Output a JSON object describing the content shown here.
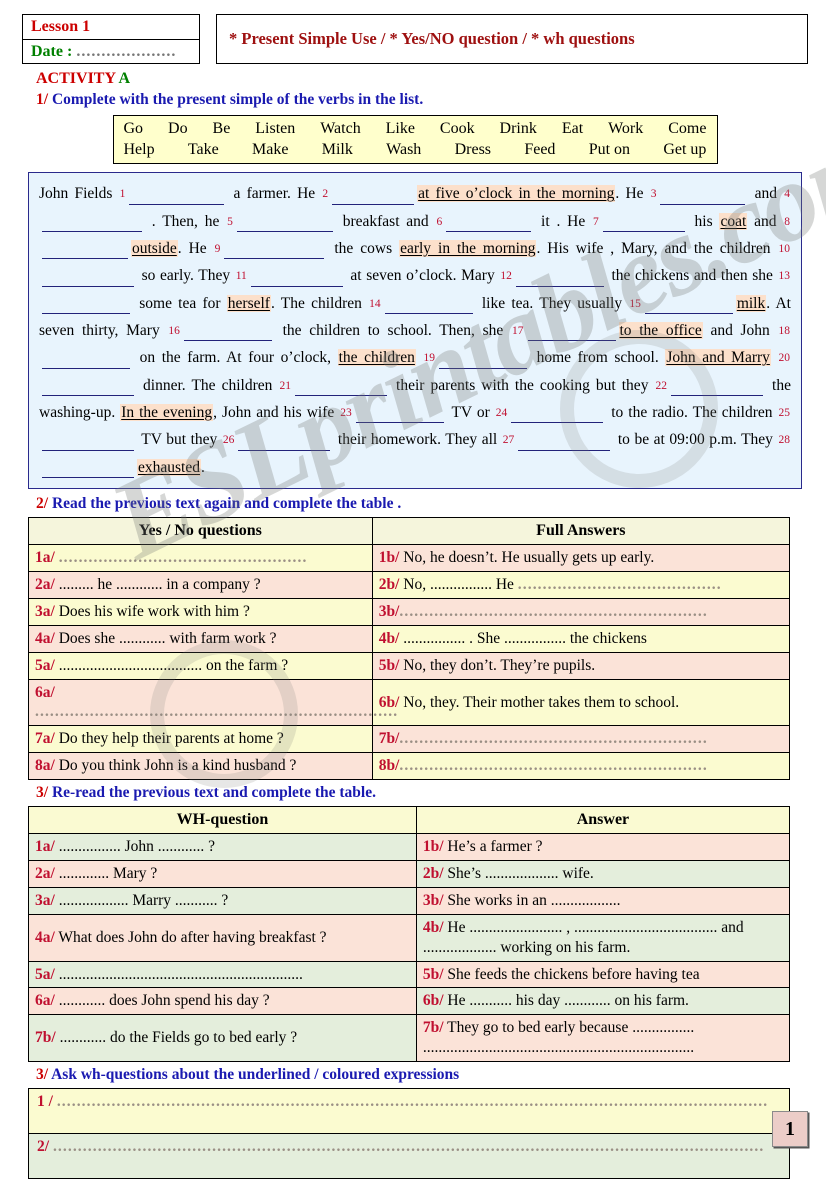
{
  "header": {
    "lesson": "Lesson 1",
    "date_label": "Date :",
    "date_dots": "....................",
    "topics": "* Present Simple Use   /  * Yes/NO question  /  * wh questions"
  },
  "activity": {
    "word": "ACTIVITY",
    "letter": "A"
  },
  "instructions": {
    "one_num": "1/",
    "one_text": "Complete with the present simple of the verbs in the list.",
    "two_num": "2/",
    "two_text": "Read the previous text again and complete the table .",
    "three_num": "3/",
    "three_text": "Re-read the previous text and complete the table.",
    "four_num": "3/",
    "four_text": "Ask wh-questions about the underlined / coloured expressions"
  },
  "verb_list": {
    "row1": [
      "Go",
      "Do",
      "Be",
      "Listen",
      "Watch",
      "Like",
      "Cook",
      "Drink",
      "Eat",
      "Work",
      "Come"
    ],
    "row2": [
      "Help",
      "Take",
      "Make",
      "Milk",
      "Wash",
      "Dress",
      "Feed",
      "Put on",
      "Get up"
    ]
  },
  "passage": {
    "segments": [
      {
        "t": "text",
        "v": "John Fields "
      },
      {
        "t": "num",
        "v": "1"
      },
      {
        "t": "gap",
        "w": 95
      },
      {
        "t": "text",
        "v": " a farmer. He "
      },
      {
        "t": "num",
        "v": "2"
      },
      {
        "t": "gap",
        "w": 82
      },
      {
        "t": "hl",
        "v": "at five o’clock in the morning"
      },
      {
        "t": "text",
        "v": ". He "
      },
      {
        "t": "num",
        "v": "3"
      },
      {
        "t": "gap",
        "w": 85
      },
      {
        "t": "text",
        "v": " and "
      },
      {
        "t": "num",
        "v": "4"
      },
      {
        "t": "gap",
        "w": 100
      },
      {
        "t": "text",
        "v": " . Then, he "
      },
      {
        "t": "num",
        "v": "5"
      },
      {
        "t": "gap",
        "w": 96
      },
      {
        "t": "text",
        "v": " breakfast and "
      },
      {
        "t": "num",
        "v": "6"
      },
      {
        "t": "gap",
        "w": 85
      },
      {
        "t": "text",
        "v": " it . He "
      },
      {
        "t": "num",
        "v": "7"
      },
      {
        "t": "gap",
        "w": 82
      },
      {
        "t": "text",
        "v": " his "
      },
      {
        "t": "hl",
        "v": "coat"
      },
      {
        "t": "text",
        "v": " and "
      },
      {
        "t": "num",
        "v": "8"
      },
      {
        "t": "gap",
        "w": 86
      },
      {
        "t": "hl",
        "v": "outside"
      },
      {
        "t": "text",
        "v": ". He "
      },
      {
        "t": "num",
        "v": "9"
      },
      {
        "t": "gap",
        "w": 100
      },
      {
        "t": "text",
        "v": " the cows "
      },
      {
        "t": "hl",
        "v": "early in the morning"
      },
      {
        "t": "text",
        "v": ". His wife , Mary, and the children "
      },
      {
        "t": "num",
        "v": "10"
      },
      {
        "t": "gap",
        "w": 92
      },
      {
        "t": "text",
        "v": " so early. They "
      },
      {
        "t": "num",
        "v": "11"
      },
      {
        "t": "gap",
        "w": 92
      },
      {
        "t": "text",
        "v": " at seven o’clock. Mary "
      },
      {
        "t": "num",
        "v": "12"
      },
      {
        "t": "gap",
        "w": 88
      },
      {
        "t": "text",
        "v": " the chickens and then she "
      },
      {
        "t": "num",
        "v": "13"
      },
      {
        "t": "gap",
        "w": 88
      },
      {
        "t": "text",
        "v": " some tea for "
      },
      {
        "t": "hl",
        "v": "herself"
      },
      {
        "t": "text",
        "v": ". The children "
      },
      {
        "t": "num",
        "v": "14"
      },
      {
        "t": "gap",
        "w": 88
      },
      {
        "t": "text",
        "v": " like tea. They usually "
      },
      {
        "t": "num",
        "v": "15"
      },
      {
        "t": "gap",
        "w": 88
      },
      {
        "t": "hl",
        "v": "milk"
      },
      {
        "t": "text",
        "v": ". At seven thirty, Mary "
      },
      {
        "t": "num",
        "v": "16"
      },
      {
        "t": "gap",
        "w": 88
      },
      {
        "t": "text",
        "v": " the children to school. Then, she "
      },
      {
        "t": "num",
        "v": "17"
      },
      {
        "t": "gap",
        "w": 88
      },
      {
        "t": "hl",
        "v": "to the office"
      },
      {
        "t": "text",
        "v": " and John "
      },
      {
        "t": "num",
        "v": "18"
      },
      {
        "t": "gap",
        "w": 88
      },
      {
        "t": "text",
        "v": " on the farm. At four o’clock, "
      },
      {
        "t": "hl",
        "v": "the children"
      },
      {
        "t": "text",
        "v": " "
      },
      {
        "t": "num",
        "v": "19"
      },
      {
        "t": "gap",
        "w": 88
      },
      {
        "t": "text",
        "v": " home from school. "
      },
      {
        "t": "hl",
        "v": "John and Marry"
      },
      {
        "t": "text",
        "v": " "
      },
      {
        "t": "num",
        "v": "20"
      },
      {
        "t": "gap",
        "w": 92
      },
      {
        "t": "text",
        "v": " dinner. The children "
      },
      {
        "t": "num",
        "v": "21"
      },
      {
        "t": "gap",
        "w": 92
      },
      {
        "t": "text",
        "v": " their parents with the cooking but they "
      },
      {
        "t": "num",
        "v": "22"
      },
      {
        "t": "gap",
        "w": 92
      },
      {
        "t": "text",
        "v": " the washing-up. "
      },
      {
        "t": "hl",
        "v": "In the evening"
      },
      {
        "t": "text",
        "v": ", John and his wife "
      },
      {
        "t": "num",
        "v": "23"
      },
      {
        "t": "gap",
        "w": 88
      },
      {
        "t": "text",
        "v": " TV or "
      },
      {
        "t": "num",
        "v": "24"
      },
      {
        "t": "gap",
        "w": 92
      },
      {
        "t": "text",
        "v": " to the radio. The children "
      },
      {
        "t": "num",
        "v": "25"
      },
      {
        "t": "gap",
        "w": 92
      },
      {
        "t": "text",
        "v": " TV but they "
      },
      {
        "t": "num",
        "v": "26"
      },
      {
        "t": "gap",
        "w": 92
      },
      {
        "t": "text",
        "v": " their homework. They all "
      },
      {
        "t": "num",
        "v": "27"
      },
      {
        "t": "gap",
        "w": 92
      },
      {
        "t": "text",
        "v": " to be at 09:00 p.m. They "
      },
      {
        "t": "num",
        "v": "28"
      },
      {
        "t": "gap",
        "w": 92
      },
      {
        "t": "hl",
        "v": "exhausted"
      },
      {
        "t": "text",
        "v": "."
      }
    ]
  },
  "table_yesno": {
    "headers": [
      "Yes / No questions",
      "Full Answers"
    ],
    "rows": [
      {
        "q_label": "1a/",
        "q_text": " ",
        "q_dots": "..................................................",
        "a_label": "1b/",
        "a_text": " No, he doesn’t. He usually gets up early.",
        "a_dots": "",
        "q_bg": "bgY",
        "a_bg": "bgP"
      },
      {
        "q_label": "2a/",
        "q_text": " ......... he ............ in a company ?",
        "q_dots": "",
        "a_label": "2b/",
        "a_text": " No, ................ He ",
        "a_dots": ".........................................",
        "q_bg": "bgP",
        "a_bg": "bgY"
      },
      {
        "q_label": "3a/",
        "q_text": " Does his wife work with him ?",
        "q_dots": "",
        "a_label": "3b/",
        "a_text": "",
        "a_dots": "..............................................................",
        "q_bg": "bgY",
        "a_bg": "bgP"
      },
      {
        "q_label": "4a/",
        "q_text": " Does she ............ with farm work ?",
        "q_dots": "",
        "a_label": "4b/",
        "a_text": " ................ . She ................ the chickens",
        "a_dots": "",
        "q_bg": "bgP",
        "a_bg": "bgY"
      },
      {
        "q_label": "5a/",
        "q_text": " ..................................... on the farm ?",
        "q_dots": "",
        "a_label": "5b/",
        "a_text": " No, they don’t. They’re pupils.",
        "a_dots": "",
        "q_bg": "bgY",
        "a_bg": "bgP"
      },
      {
        "q_label": "6a/",
        "q_text": "",
        "q_dots": ".........................................................................",
        "a_label": "6b/",
        "a_text": " No, they. Their mother takes them to school.",
        "a_dots": "",
        "q_bg": "bgP",
        "a_bg": "bgY"
      },
      {
        "q_label": "7a/",
        "q_text": " Do they help their parents at home ?",
        "q_dots": "",
        "a_label": "7b/",
        "a_text": "",
        "a_dots": "..............................................................",
        "q_bg": "bgY",
        "a_bg": "bgP"
      },
      {
        "q_label": "8a/",
        "q_text": " Do you think John is a kind husband ?",
        "q_dots": "",
        "a_label": "8b/",
        "a_text": "",
        "a_dots": "..............................................................",
        "q_bg": "bgP",
        "a_bg": "bgY"
      }
    ]
  },
  "table_wh": {
    "headers": [
      "WH-question",
      "Answer"
    ],
    "rows": [
      {
        "q_label": "1a/",
        "q_text": " ................ John ............ ?",
        "a_label": "1b/",
        "a_text": " He’s a farmer ?",
        "q_bg": "bgG",
        "a_bg": "bgP"
      },
      {
        "q_label": "2a/",
        "q_text": " ............. Mary ?",
        "a_label": "2b/",
        "a_text": " She’s ................... wife.",
        "q_bg": "bgP",
        "a_bg": "bgG"
      },
      {
        "q_label": "3a/",
        "q_text": " .................. Marry ........... ?",
        "a_label": "3b/",
        "a_text": " She works in an ..................",
        "q_bg": "bgG",
        "a_bg": "bgP"
      },
      {
        "q_label": "4a/",
        "q_text": " What does John do after having breakfast ?",
        "a_label": "4b/",
        "a_text": " He ........................ , ..................................... and ................... working on his farm.",
        "q_bg": "bgP",
        "a_bg": "bgG"
      },
      {
        "q_label": "5a/",
        "q_text": " ...............................................................",
        "a_label": "5b/",
        "a_text": " She feeds the chickens before having tea",
        "q_bg": "bgG",
        "a_bg": "bgP"
      },
      {
        "q_label": "6a/",
        "q_text": " ............ does John spend his day ?",
        "a_label": "6b/",
        "a_text": " He ........... his day ............ on his farm.",
        "q_bg": "bgP",
        "a_bg": "bgG"
      },
      {
        "q_label": "7b/",
        "q_text": " ............ do the Fields go to bed early ?",
        "a_label": "7b/",
        "a_text": " They go to bed early because ................ ......................................................................",
        "q_bg": "bgG",
        "a_bg": "bgP"
      }
    ]
  },
  "bottom": {
    "rows": [
      {
        "label": "1 /",
        "dots": "...............................................................................................................................................",
        "bg": "bgY"
      },
      {
        "label": "2/",
        "dots": "...............................................................................................................................................",
        "bg": "bgG"
      }
    ]
  },
  "page_number": "1",
  "watermark": {
    "text": "ESLprintables.com"
  }
}
